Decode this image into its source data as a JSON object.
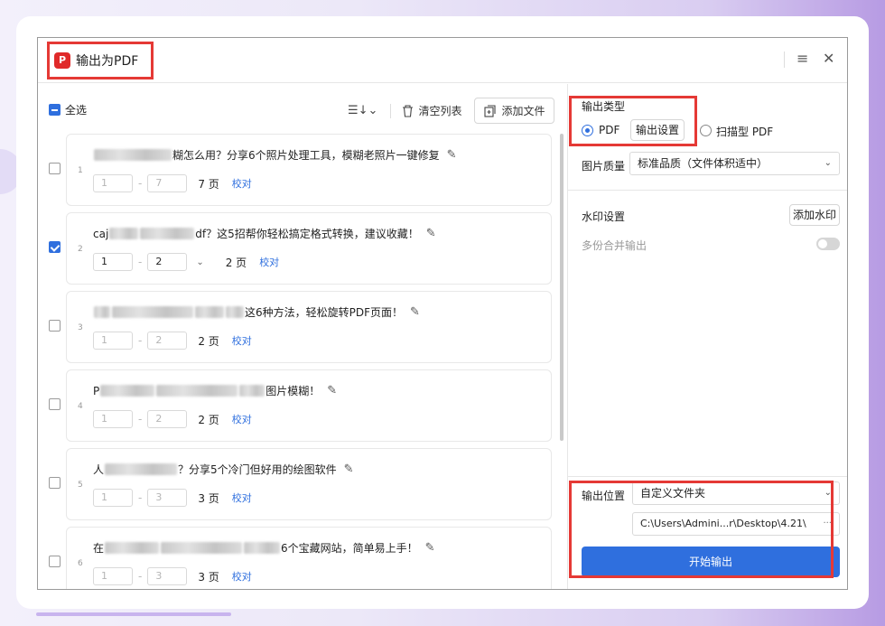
{
  "window": {
    "title": "输出为PDF",
    "app_icon": "pdf-icon",
    "menu_icon": "≡",
    "close_icon": "✕"
  },
  "list_toolbar": {
    "select_all": "全选",
    "sort_icon": "☰↓⌄",
    "clear": "清空列表",
    "add_file": "添加文件"
  },
  "files": [
    {
      "num": "1",
      "title_pre": "",
      "title_post": "糊怎么用？分享6个照片处理工具，模糊老照片一键修复",
      "from": "1",
      "to": "7",
      "pages": "7 页",
      "proof": "校对",
      "checked": false,
      "editable": false
    },
    {
      "num": "2",
      "title_pre": "caj",
      "title_post": "df？这5招帮你轻松搞定格式转换，建议收藏！",
      "from": "1",
      "to": "2",
      "pages": "2 页",
      "proof": "校对",
      "checked": true,
      "editable": true
    },
    {
      "num": "3",
      "title_pre": "",
      "title_post": "这6种方法，轻松旋转PDF页面！",
      "from": "1",
      "to": "2",
      "pages": "2 页",
      "proof": "校对",
      "checked": false,
      "editable": false
    },
    {
      "num": "4",
      "title_pre": "P",
      "title_post": "图片模糊！",
      "from": "1",
      "to": "2",
      "pages": "2 页",
      "proof": "校对",
      "checked": false,
      "editable": false
    },
    {
      "num": "5",
      "title_pre": "人",
      "title_post": "？分享5个冷门但好用的绘图软件",
      "from": "1",
      "to": "3",
      "pages": "3 页",
      "proof": "校对",
      "checked": false,
      "editable": false
    },
    {
      "num": "6",
      "title_pre": "在",
      "title_post": "6个宝藏网站，简单易上手！",
      "from": "1",
      "to": "3",
      "pages": "3 页",
      "proof": "校对",
      "checked": false,
      "editable": false
    }
  ],
  "settings": {
    "output_type_label": "输出类型",
    "option_pdf": "PDF",
    "output_settings_btn": "输出设置",
    "option_scan": "扫描型 PDF",
    "quality_label": "图片质量",
    "quality_value": "标准品质（文件体积适中）",
    "watermark_label": "水印设置",
    "add_watermark": "添加水印",
    "merge_label": "多份合并输出",
    "output_location_label": "输出位置",
    "output_location_value": "自定义文件夹",
    "output_path": "C:\\Users\\Admini...r\\Desktop\\4.21\\",
    "more": "···",
    "start": "开始输出"
  }
}
